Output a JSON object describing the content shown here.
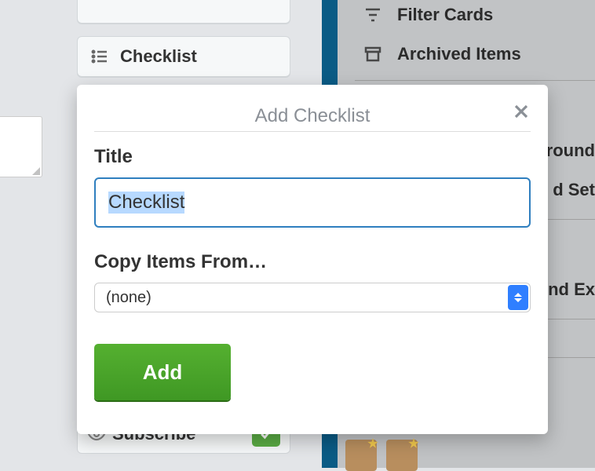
{
  "sidebar": {
    "checklist_button_label": "Checklist",
    "subscribe_label": "Subscribe"
  },
  "right_menu": {
    "items": [
      {
        "label": "Filter Cards"
      },
      {
        "label": "Archived Items"
      },
      {
        "label_partial_1": "ground"
      },
      {
        "label_partial_2": "d Set"
      },
      {
        "label_partial_3": "nd Ex"
      }
    ]
  },
  "popover": {
    "header": "Add Checklist",
    "title_label": "Title",
    "title_value": "Checklist",
    "copy_label": "Copy Items From…",
    "copy_selected": "(none)",
    "add_button": "Add"
  }
}
